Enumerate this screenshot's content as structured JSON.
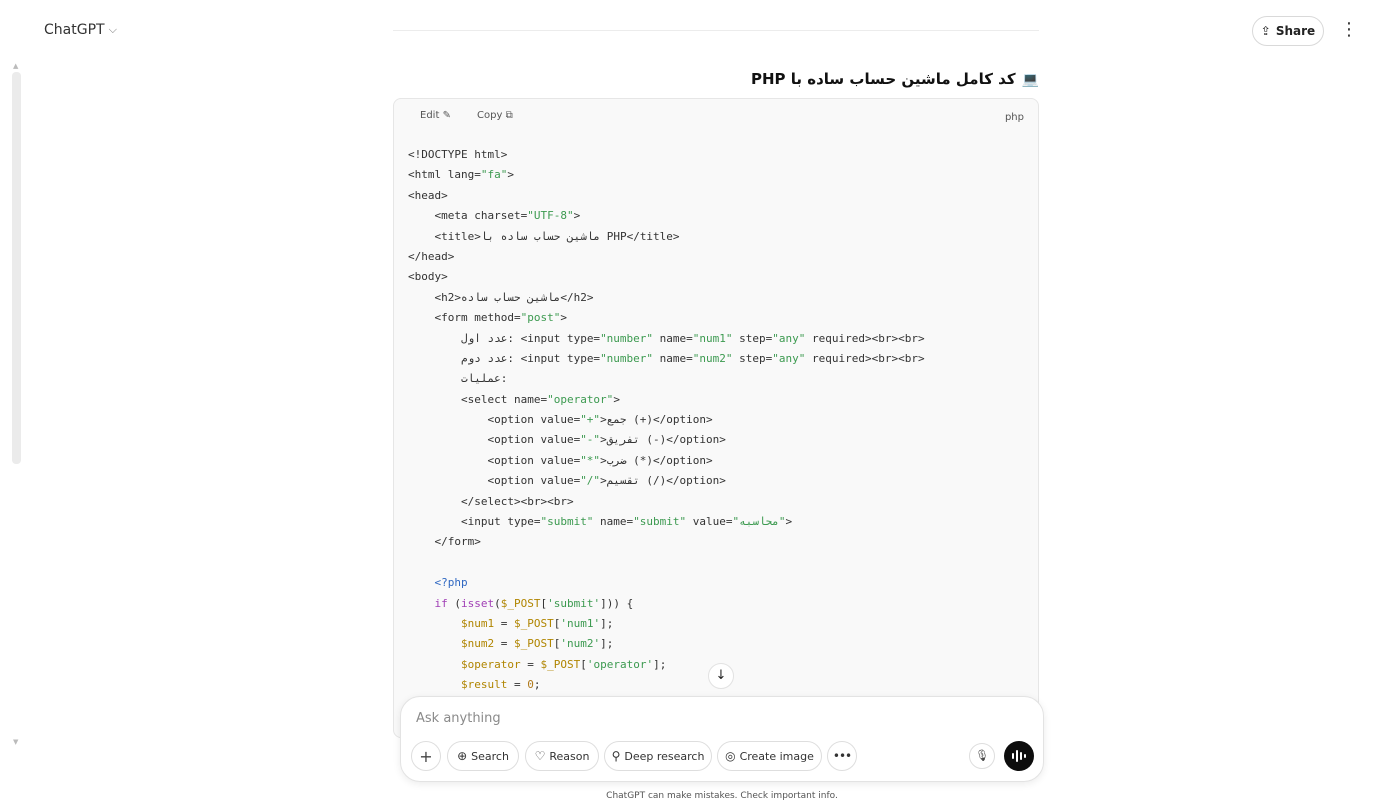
{
  "header": {
    "model": "ChatGPT",
    "model_chevron": "⌵",
    "share_label": "Share",
    "share_icon": "⇪",
    "menu_icon": "⋮"
  },
  "message": {
    "heading": "کد کامل ماشین حساب ساده با PHP",
    "heading_icon": "💻"
  },
  "code_block": {
    "edit_label": "Edit",
    "edit_icon": "✎",
    "copy_label": "Copy",
    "copy_icon": "⧉",
    "language": "php",
    "lines": [
      [
        {
          "t": "<!DOCTYPE html>"
        }
      ],
      [
        {
          "t": "<html lang="
        },
        {
          "t": "\"fa\"",
          "c": "s"
        },
        {
          "t": ">"
        }
      ],
      [
        {
          "t": "<head>"
        }
      ],
      [
        {
          "t": "    <meta charset="
        },
        {
          "t": "\"UTF-8\"",
          "c": "s"
        },
        {
          "t": ">"
        }
      ],
      [
        {
          "t": "    <title>ماشین حساب ساده با PHP</title>"
        }
      ],
      [
        {
          "t": "</head>"
        }
      ],
      [
        {
          "t": "<body>"
        }
      ],
      [
        {
          "t": "    <h2>ماشین حساب ساده</h2>"
        }
      ],
      [
        {
          "t": "    <form method="
        },
        {
          "t": "\"post\"",
          "c": "s"
        },
        {
          "t": ">"
        }
      ],
      [
        {
          "t": "        عدد اول: <input type="
        },
        {
          "t": "\"number\"",
          "c": "s"
        },
        {
          "t": " name="
        },
        {
          "t": "\"num1\"",
          "c": "s"
        },
        {
          "t": " step="
        },
        {
          "t": "\"any\"",
          "c": "s"
        },
        {
          "t": " required><br><br>"
        }
      ],
      [
        {
          "t": "        عدد دوم: <input type="
        },
        {
          "t": "\"number\"",
          "c": "s"
        },
        {
          "t": " name="
        },
        {
          "t": "\"num2\"",
          "c": "s"
        },
        {
          "t": " step="
        },
        {
          "t": "\"any\"",
          "c": "s"
        },
        {
          "t": " required><br><br>"
        }
      ],
      [
        {
          "t": "        عملیات:"
        }
      ],
      [
        {
          "t": "        <select name="
        },
        {
          "t": "\"operator\"",
          "c": "s"
        },
        {
          "t": ">"
        }
      ],
      [
        {
          "t": "            <option value="
        },
        {
          "t": "\"+\"",
          "c": "s"
        },
        {
          "t": ">جمع (+)</option>"
        }
      ],
      [
        {
          "t": "            <option value="
        },
        {
          "t": "\"-\"",
          "c": "s"
        },
        {
          "t": ">تفریق (-)</option>"
        }
      ],
      [
        {
          "t": "            <option value="
        },
        {
          "t": "\"*\"",
          "c": "s"
        },
        {
          "t": ">ضرب (*)</option>"
        }
      ],
      [
        {
          "t": "            <option value="
        },
        {
          "t": "\"/\"",
          "c": "s"
        },
        {
          "t": ">تقسیم (/)</option>"
        }
      ],
      [
        {
          "t": "        </select><br><br>"
        }
      ],
      [
        {
          "t": "        <input type="
        },
        {
          "t": "\"submit\"",
          "c": "s"
        },
        {
          "t": " name="
        },
        {
          "t": "\"submit\"",
          "c": "s"
        },
        {
          "t": " value="
        },
        {
          "t": "\"محاسبه\"",
          "c": "s"
        },
        {
          "t": ">"
        }
      ],
      [
        {
          "t": "    </form>"
        }
      ],
      [
        {
          "t": ""
        }
      ],
      [
        {
          "t": "    "
        },
        {
          "t": "<?php",
          "c": "t"
        }
      ],
      [
        {
          "t": "    "
        },
        {
          "t": "if",
          "c": "k"
        },
        {
          "t": " ("
        },
        {
          "t": "isset",
          "c": "k"
        },
        {
          "t": "("
        },
        {
          "t": "$_POST",
          "c": "v"
        },
        {
          "t": "["
        },
        {
          "t": "'submit'",
          "c": "s"
        },
        {
          "t": "])) {"
        }
      ],
      [
        {
          "t": "        "
        },
        {
          "t": "$num1",
          "c": "v"
        },
        {
          "t": " = "
        },
        {
          "t": "$_POST",
          "c": "v"
        },
        {
          "t": "["
        },
        {
          "t": "'num1'",
          "c": "s"
        },
        {
          "t": "];"
        }
      ],
      [
        {
          "t": "        "
        },
        {
          "t": "$num2",
          "c": "v"
        },
        {
          "t": " = "
        },
        {
          "t": "$_POST",
          "c": "v"
        },
        {
          "t": "["
        },
        {
          "t": "'num2'",
          "c": "s"
        },
        {
          "t": "];"
        }
      ],
      [
        {
          "t": "        "
        },
        {
          "t": "$operator",
          "c": "v"
        },
        {
          "t": " = "
        },
        {
          "t": "$_POST",
          "c": "v"
        },
        {
          "t": "["
        },
        {
          "t": "'operator'",
          "c": "s"
        },
        {
          "t": "];"
        }
      ],
      [
        {
          "t": "        "
        },
        {
          "t": "$result",
          "c": "v"
        },
        {
          "t": " = "
        },
        {
          "t": "0",
          "c": "n"
        },
        {
          "t": ";"
        }
      ]
    ]
  },
  "composer": {
    "placeholder": "Ask anything",
    "attach_icon": "+",
    "tools": {
      "search": {
        "label": "Search",
        "icon": "⊕"
      },
      "reason": {
        "label": "Reason",
        "icon": "♡"
      },
      "deep_research": {
        "label": "Deep research",
        "icon": "⚲"
      },
      "create_image": {
        "label": "Create image",
        "icon": "◎"
      }
    },
    "more_icon": "•••",
    "mic_icon": "🎙",
    "scroll_down_icon": "↓"
  },
  "footer": {
    "disclaimer": "ChatGPT can make mistakes. Check important info."
  },
  "colors": {
    "code_string": "#3c9a50",
    "code_keyword": "#a03fb5",
    "code_variable": "#b08500",
    "code_tag": "#2f68c2",
    "voice_button": "#0d0d0d"
  }
}
